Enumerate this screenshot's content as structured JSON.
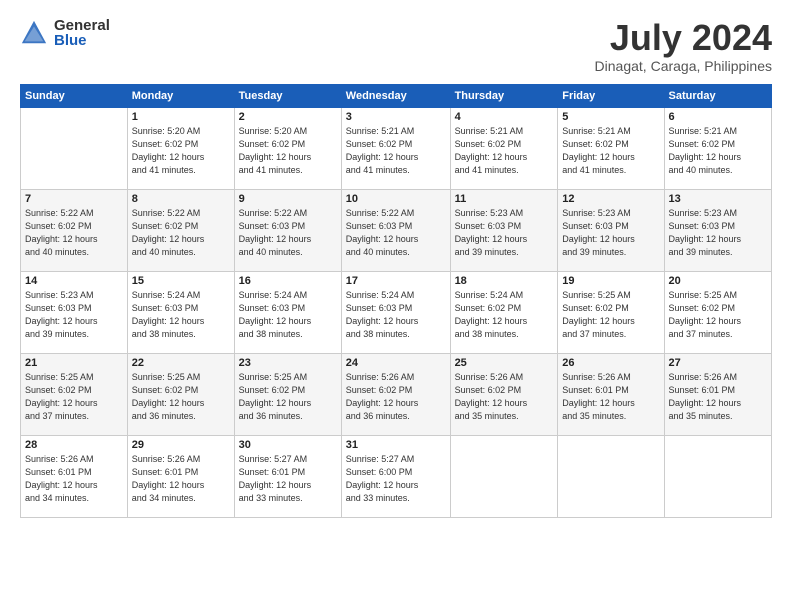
{
  "header": {
    "logo_general": "General",
    "logo_blue": "Blue",
    "title": "July 2024",
    "subtitle": "Dinagat, Caraga, Philippines"
  },
  "calendar": {
    "days_of_week": [
      "Sunday",
      "Monday",
      "Tuesday",
      "Wednesday",
      "Thursday",
      "Friday",
      "Saturday"
    ],
    "weeks": [
      [
        {
          "day": "",
          "info": ""
        },
        {
          "day": "1",
          "info": "Sunrise: 5:20 AM\nSunset: 6:02 PM\nDaylight: 12 hours\nand 41 minutes."
        },
        {
          "day": "2",
          "info": "Sunrise: 5:20 AM\nSunset: 6:02 PM\nDaylight: 12 hours\nand 41 minutes."
        },
        {
          "day": "3",
          "info": "Sunrise: 5:21 AM\nSunset: 6:02 PM\nDaylight: 12 hours\nand 41 minutes."
        },
        {
          "day": "4",
          "info": "Sunrise: 5:21 AM\nSunset: 6:02 PM\nDaylight: 12 hours\nand 41 minutes."
        },
        {
          "day": "5",
          "info": "Sunrise: 5:21 AM\nSunset: 6:02 PM\nDaylight: 12 hours\nand 41 minutes."
        },
        {
          "day": "6",
          "info": "Sunrise: 5:21 AM\nSunset: 6:02 PM\nDaylight: 12 hours\nand 40 minutes."
        }
      ],
      [
        {
          "day": "7",
          "info": "Sunrise: 5:22 AM\nSunset: 6:02 PM\nDaylight: 12 hours\nand 40 minutes."
        },
        {
          "day": "8",
          "info": "Sunrise: 5:22 AM\nSunset: 6:02 PM\nDaylight: 12 hours\nand 40 minutes."
        },
        {
          "day": "9",
          "info": "Sunrise: 5:22 AM\nSunset: 6:03 PM\nDaylight: 12 hours\nand 40 minutes."
        },
        {
          "day": "10",
          "info": "Sunrise: 5:22 AM\nSunset: 6:03 PM\nDaylight: 12 hours\nand 40 minutes."
        },
        {
          "day": "11",
          "info": "Sunrise: 5:23 AM\nSunset: 6:03 PM\nDaylight: 12 hours\nand 39 minutes."
        },
        {
          "day": "12",
          "info": "Sunrise: 5:23 AM\nSunset: 6:03 PM\nDaylight: 12 hours\nand 39 minutes."
        },
        {
          "day": "13",
          "info": "Sunrise: 5:23 AM\nSunset: 6:03 PM\nDaylight: 12 hours\nand 39 minutes."
        }
      ],
      [
        {
          "day": "14",
          "info": "Sunrise: 5:23 AM\nSunset: 6:03 PM\nDaylight: 12 hours\nand 39 minutes."
        },
        {
          "day": "15",
          "info": "Sunrise: 5:24 AM\nSunset: 6:03 PM\nDaylight: 12 hours\nand 38 minutes."
        },
        {
          "day": "16",
          "info": "Sunrise: 5:24 AM\nSunset: 6:03 PM\nDaylight: 12 hours\nand 38 minutes."
        },
        {
          "day": "17",
          "info": "Sunrise: 5:24 AM\nSunset: 6:03 PM\nDaylight: 12 hours\nand 38 minutes."
        },
        {
          "day": "18",
          "info": "Sunrise: 5:24 AM\nSunset: 6:02 PM\nDaylight: 12 hours\nand 38 minutes."
        },
        {
          "day": "19",
          "info": "Sunrise: 5:25 AM\nSunset: 6:02 PM\nDaylight: 12 hours\nand 37 minutes."
        },
        {
          "day": "20",
          "info": "Sunrise: 5:25 AM\nSunset: 6:02 PM\nDaylight: 12 hours\nand 37 minutes."
        }
      ],
      [
        {
          "day": "21",
          "info": "Sunrise: 5:25 AM\nSunset: 6:02 PM\nDaylight: 12 hours\nand 37 minutes."
        },
        {
          "day": "22",
          "info": "Sunrise: 5:25 AM\nSunset: 6:02 PM\nDaylight: 12 hours\nand 36 minutes."
        },
        {
          "day": "23",
          "info": "Sunrise: 5:25 AM\nSunset: 6:02 PM\nDaylight: 12 hours\nand 36 minutes."
        },
        {
          "day": "24",
          "info": "Sunrise: 5:26 AM\nSunset: 6:02 PM\nDaylight: 12 hours\nand 36 minutes."
        },
        {
          "day": "25",
          "info": "Sunrise: 5:26 AM\nSunset: 6:02 PM\nDaylight: 12 hours\nand 35 minutes."
        },
        {
          "day": "26",
          "info": "Sunrise: 5:26 AM\nSunset: 6:01 PM\nDaylight: 12 hours\nand 35 minutes."
        },
        {
          "day": "27",
          "info": "Sunrise: 5:26 AM\nSunset: 6:01 PM\nDaylight: 12 hours\nand 35 minutes."
        }
      ],
      [
        {
          "day": "28",
          "info": "Sunrise: 5:26 AM\nSunset: 6:01 PM\nDaylight: 12 hours\nand 34 minutes."
        },
        {
          "day": "29",
          "info": "Sunrise: 5:26 AM\nSunset: 6:01 PM\nDaylight: 12 hours\nand 34 minutes."
        },
        {
          "day": "30",
          "info": "Sunrise: 5:27 AM\nSunset: 6:01 PM\nDaylight: 12 hours\nand 33 minutes."
        },
        {
          "day": "31",
          "info": "Sunrise: 5:27 AM\nSunset: 6:00 PM\nDaylight: 12 hours\nand 33 minutes."
        },
        {
          "day": "",
          "info": ""
        },
        {
          "day": "",
          "info": ""
        },
        {
          "day": "",
          "info": ""
        }
      ]
    ]
  }
}
